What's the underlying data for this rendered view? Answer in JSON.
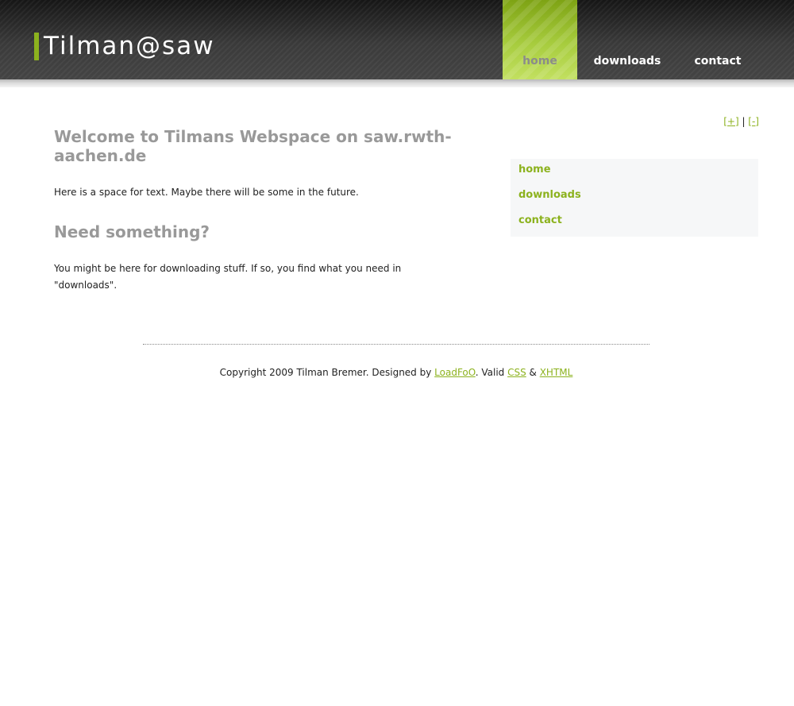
{
  "header": {
    "logo_text": "Tilman@saw",
    "nav": [
      {
        "label": "home",
        "active": true
      },
      {
        "label": "downloads",
        "active": false
      },
      {
        "label": "contact",
        "active": false
      }
    ]
  },
  "font_controls": {
    "increase": "[+]",
    "separator": " | ",
    "decrease": "[-]"
  },
  "main": {
    "title": "Welcome to Tilmans Webspace on saw.rwth-aachen.de",
    "intro": "Here is a space for text. Maybe there will be some in the future.",
    "subtitle": "Need something?",
    "body": "You might be here for downloading stuff. If so, you find what you need in \"downloads\"."
  },
  "sidebar": {
    "items": [
      {
        "label": "home"
      },
      {
        "label": "downloads"
      },
      {
        "label": "contact"
      }
    ]
  },
  "footer": {
    "prefix": "Copyright 2009 Tilman Bremer. Designed by ",
    "designer_link": "LoadFoO",
    "middle": ". Valid ",
    "css_link": "CSS",
    "amp": " & ",
    "xhtml_link": "XHTML"
  },
  "colors": {
    "accent": "#8cb21e",
    "heading": "#999999",
    "header_bg": "#2e2e2e",
    "sidebar_bg": "#f6f7f8"
  }
}
